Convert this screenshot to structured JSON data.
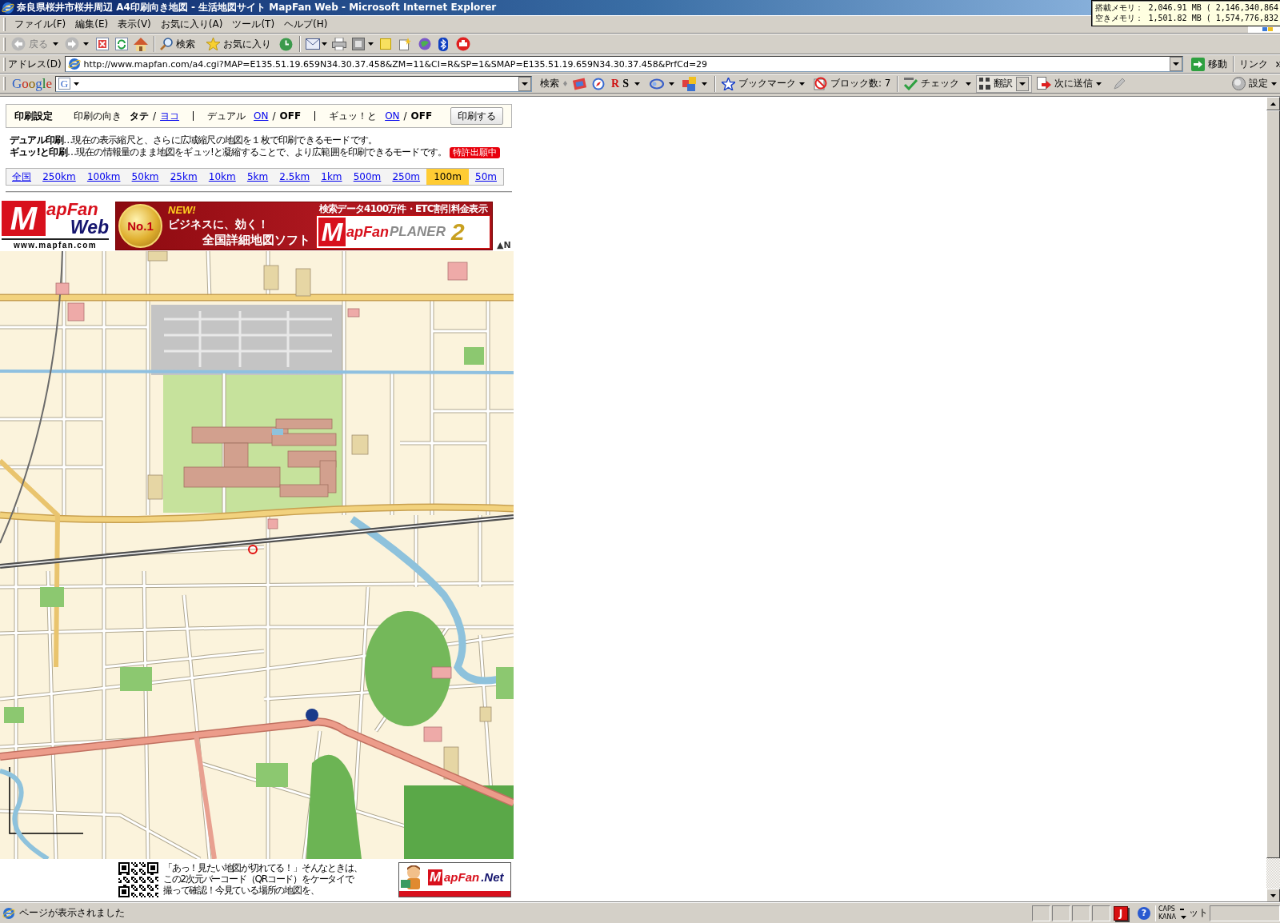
{
  "window": {
    "title": "奈良県桜井市桜井周辺 A4印刷向き地図 - 生活地図サイト MapFan Web - Microsoft Internet Explorer"
  },
  "memory_tooltip": {
    "lines": [
      "搭載メモリ： 2,046.91 MB ( 2,146,340,864",
      "空きメモリ： 1,501.82 MB ( 1,574,776,832"
    ]
  },
  "menu": [
    "ファイル(F)",
    "編集(E)",
    "表示(V)",
    "お気に入り(A)",
    "ツール(T)",
    "ヘルプ(H)"
  ],
  "toolbar": {
    "back": {
      "label": "戻る",
      "disabled": true
    },
    "forward": {
      "disabled": true
    },
    "search": "検索",
    "favorites": "お気に入り"
  },
  "address_bar": {
    "label": "アドレス(D)",
    "url": "http://www.mapfan.com/a4.cgi?MAP=E135.51.19.659N34.30.37.458&ZM=11&CI=R&SP=1&SMAP=E135.51.19.659N34.30.37.458&PrfCd=29",
    "go": "移動",
    "links": "リンク"
  },
  "google_toolbar": {
    "logo": "Google",
    "engine": "G",
    "search": "検索",
    "rs": "RS",
    "bookmarks": "ブックマーク",
    "blocked": "ブロック数: 7",
    "check": "チェック",
    "translate": "翻訳",
    "send": "次に送信",
    "settings": "設定"
  },
  "print_settings": {
    "title": "印刷設定",
    "groups": [
      {
        "label": "印刷の向き",
        "separator": "/",
        "options": [
          {
            "label": "タテ",
            "selected": true
          },
          {
            "label": "ヨコ",
            "selected": false
          }
        ]
      },
      {
        "label": "デュアル",
        "separator": "/",
        "options": [
          {
            "label": "ON",
            "selected": false
          },
          {
            "label": "OFF",
            "selected": true
          }
        ]
      },
      {
        "label": "ギュッ！と",
        "separator": "/",
        "options": [
          {
            "label": "ON",
            "selected": false
          },
          {
            "label": "OFF",
            "selected": true
          }
        ]
      }
    ],
    "button": "印刷する"
  },
  "descriptions": [
    {
      "text": "**デュアル印刷**…現在の表示縮尺と、さらに広域縮尺の地図を１枚で印刷できるモードです。"
    },
    {
      "text": "**ギュッ!と印刷**…現在の情報量のまま地図をギュッ!と凝縮することで、より広範囲を印刷できるモードです。",
      "badge": "特許出願中"
    }
  ],
  "scales": [
    {
      "label": "全国",
      "selected": false
    },
    {
      "label": "250km",
      "selected": false
    },
    {
      "label": "100km",
      "selected": false
    },
    {
      "label": "50km",
      "selected": false
    },
    {
      "label": "25km",
      "selected": false
    },
    {
      "label": "10km",
      "selected": false
    },
    {
      "label": "5km",
      "selected": false
    },
    {
      "label": "2.5km",
      "selected": false
    },
    {
      "label": "1km",
      "selected": false
    },
    {
      "label": "500m",
      "selected": false
    },
    {
      "label": "250m",
      "selected": false
    },
    {
      "label": "100m",
      "selected": true
    },
    {
      "label": "50m",
      "selected": false
    }
  ],
  "logo": {
    "initial": "M",
    "name": "apFan",
    "product": "Web",
    "url": "www.mapfan.com"
  },
  "banner": {
    "medal": "No.1",
    "tag": "NEW!",
    "headline": "ビジネスに、効く！",
    "subline": "全国詳細地図ソフト",
    "caption": "検索データ4100万件・ETC割引料金表示",
    "initial": "M",
    "name": "apFan",
    "product": "PLANER",
    "version": "2"
  },
  "north": "▲N",
  "qr_promo": {
    "lines": [
      "「あっ！見たい地図が切れてる！」そんなときは、",
      "この2次元バーコード（QRコード）をケータイで",
      "撮って確認！今見ている場所の地図を、"
    ]
  },
  "net_banner": {
    "initial": "M",
    "name": "apFan",
    "suffix": ".Net"
  },
  "status_bar": {
    "text": "ページが表示されました",
    "ime": "J",
    "help": "?",
    "caps": "CAPS",
    "kana": "KANA",
    "zone": "ット"
  }
}
